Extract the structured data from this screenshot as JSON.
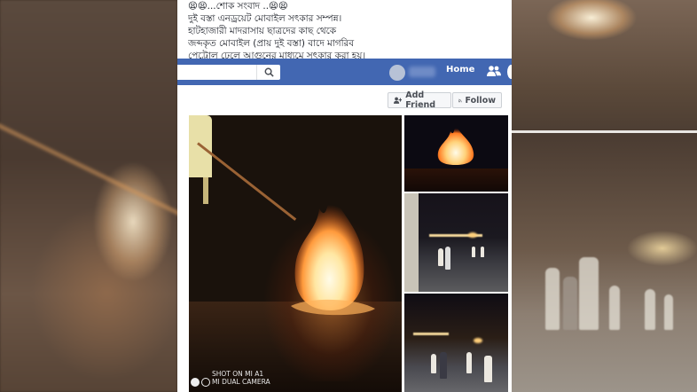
{
  "post": {
    "lines": [
      "😫😫...শোক সংবাদ ..😫😫",
      "দুই বস্তা এনড্রয়েট মোবাইল সৎকার সম্পন্ন।",
      "হাটহাজারী মাদরাসায় ছাত্রদের কাছ থেকে",
      "জব্দকৃত মোবাইল (প্রায় দুই বস্তা) বাদে মাগরিব",
      "পেট্রোল ঢেলে আগুনের মাধ্যমে সৎকার করা হয়।"
    ]
  },
  "navbar": {
    "home_label": "Home",
    "search_placeholder": "",
    "search_icon": "search-icon",
    "friends_icon": "friends-icon",
    "color": "#4267b2"
  },
  "actions": {
    "add_friend_label": "Add Friend",
    "follow_label": "Follow",
    "add_friend_icon": "add-friend-icon",
    "follow_icon": "rss-icon"
  },
  "photo": {
    "camera_watermark_line1": "SHOT ON MI A1",
    "camera_watermark_line2": "MI DUAL CAMERA"
  }
}
